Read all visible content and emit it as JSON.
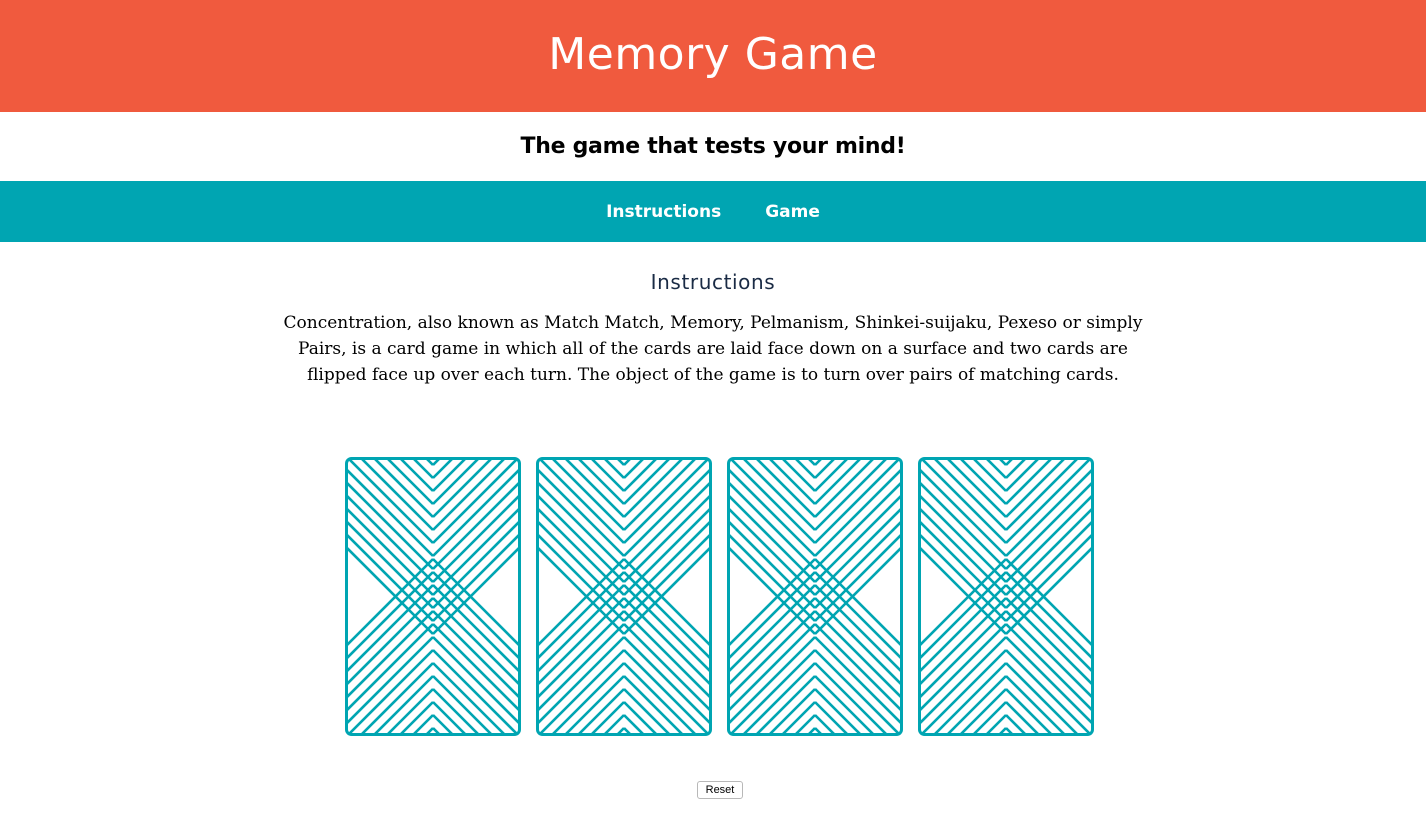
{
  "header": {
    "title": "Memory Game"
  },
  "tagline": {
    "text": "The game that tests your mind!"
  },
  "nav": {
    "items": [
      {
        "label": "Instructions"
      },
      {
        "label": "Game"
      }
    ]
  },
  "instructions": {
    "heading": "Instructions",
    "body": "Concentration, also known as Match Match, Memory, Pelmanism, Shinkei-suijaku, Pexeso or simply Pairs, is a card game in which all of the cards are laid face down on a surface and two cards are flipped face up over each turn. The object of the game is to turn over pairs of matching cards."
  },
  "game": {
    "cards": [
      {
        "state": "face-down"
      },
      {
        "state": "face-down"
      },
      {
        "state": "face-down"
      },
      {
        "state": "face-down"
      }
    ],
    "reset_label": "Reset"
  },
  "colors": {
    "header_bg": "#f05a3e",
    "nav_bg": "#00a5b2",
    "card_pattern": "#00a5b2",
    "heading_text": "#1a2b45"
  },
  "icons": {
    "card_back": "chevron-pattern-card-back-icon"
  }
}
